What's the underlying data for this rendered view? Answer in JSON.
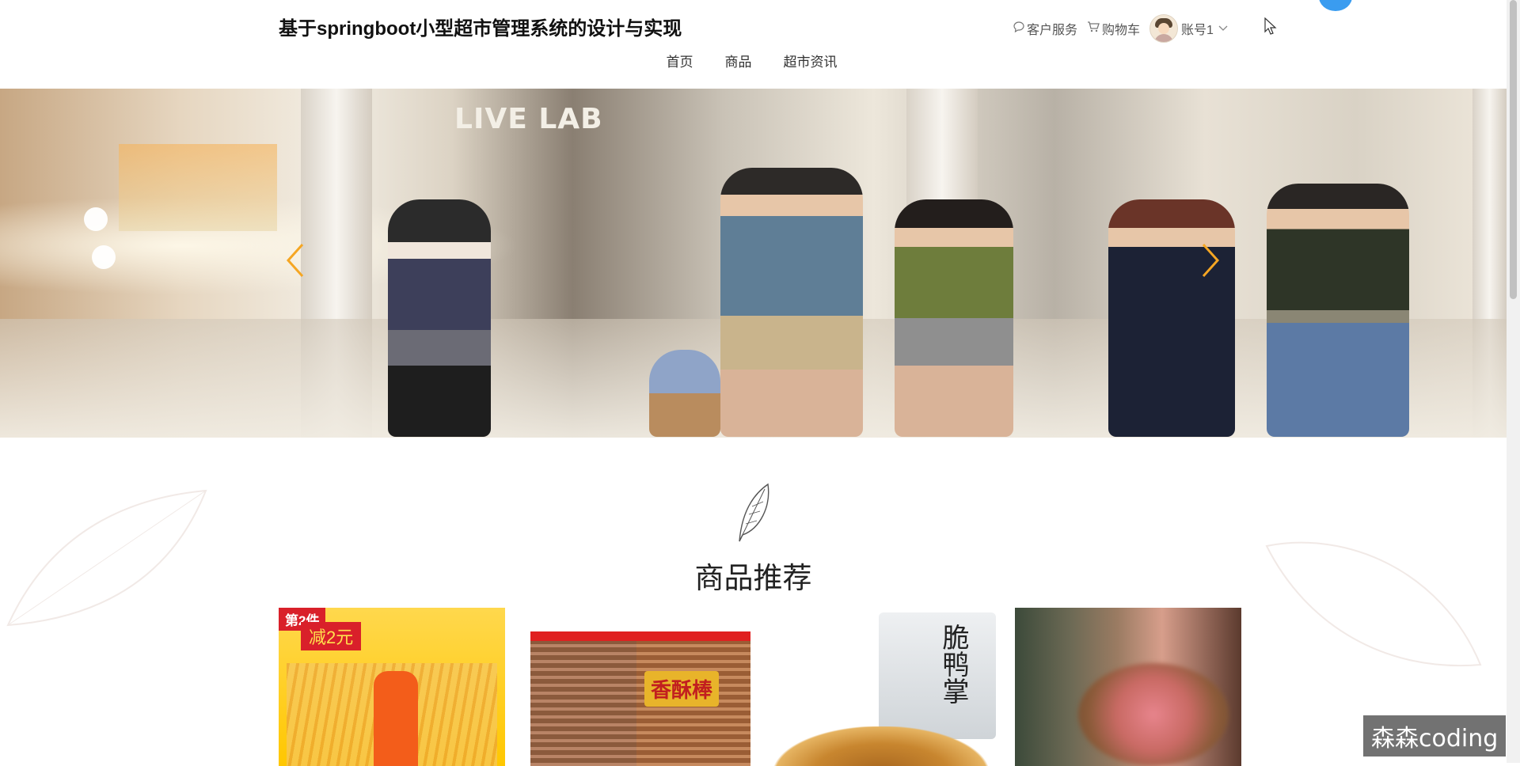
{
  "header": {
    "site_title": "基于springboot小型超市管理系统的设计与实现",
    "links": {
      "customer_service": "客户服务",
      "cart": "购物车",
      "account": "账号1"
    }
  },
  "nav": {
    "items": [
      "首页",
      "商品",
      "超市资讯"
    ]
  },
  "banner": {
    "sign_text": "LIVE LAB"
  },
  "recommend": {
    "title": "商品推荐",
    "products": [
      {
        "tag": "第2件",
        "promo": "减2元"
      },
      {
        "label": "香酥棒"
      },
      {
        "label": "脆鸭掌"
      },
      {}
    ]
  },
  "watermark": "森森coding",
  "colors": {
    "arrow": "#f5a623",
    "title_text": "#222222"
  }
}
